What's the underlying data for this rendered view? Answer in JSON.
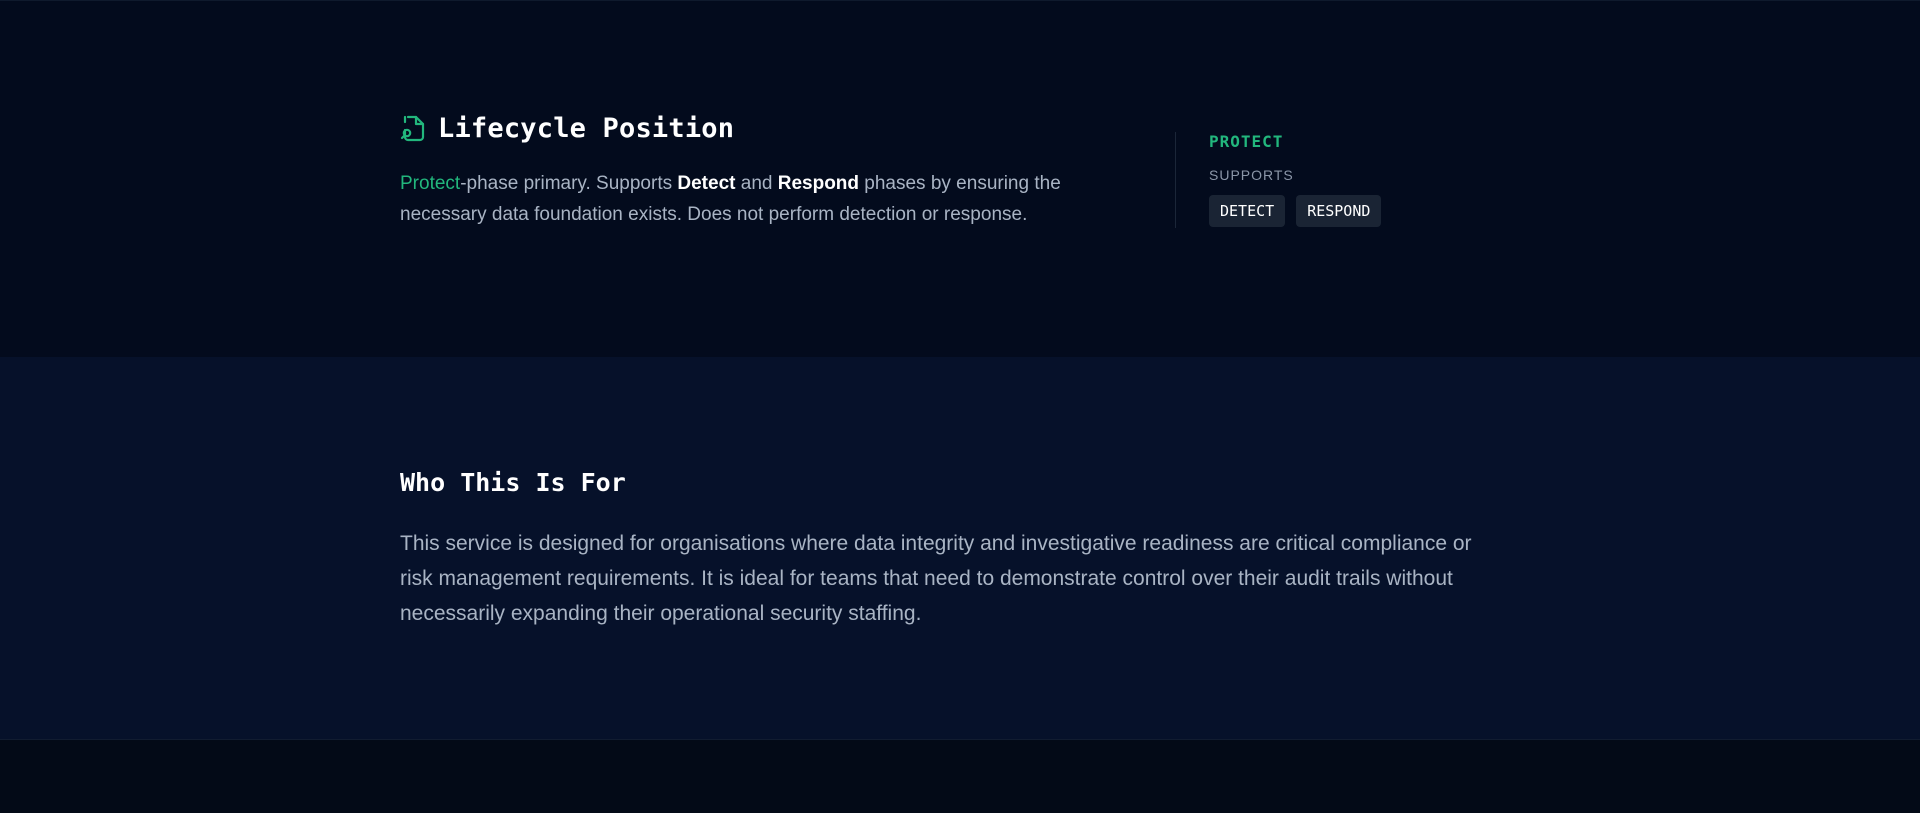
{
  "lifecycle": {
    "icon": "file-search-icon",
    "title": "Lifecycle Position",
    "desc": {
      "protect": "Protect",
      "part1": "-phase primary. Supports ",
      "detect": "Detect",
      "part2": " and ",
      "respond": "Respond",
      "part3": " phases by ensuring the necessary data foundation exists. Does not perform detection or response."
    },
    "phase_label": "PROTECT",
    "supports_label": "SUPPORTS",
    "tags": [
      "DETECT",
      "RESPOND"
    ]
  },
  "who": {
    "title": "Who This Is For",
    "desc": "This service is designed for organisations where data integrity and investigative readiness are critical compliance or risk management requirements. It is ideal for teams that need to demonstrate control over their audit trails without necessarily expanding their operational security staffing."
  },
  "colors": {
    "accent": "#22b77d",
    "background": "#030b1d",
    "section_alt": "#06112a",
    "tag_bg": "#1a2434"
  }
}
